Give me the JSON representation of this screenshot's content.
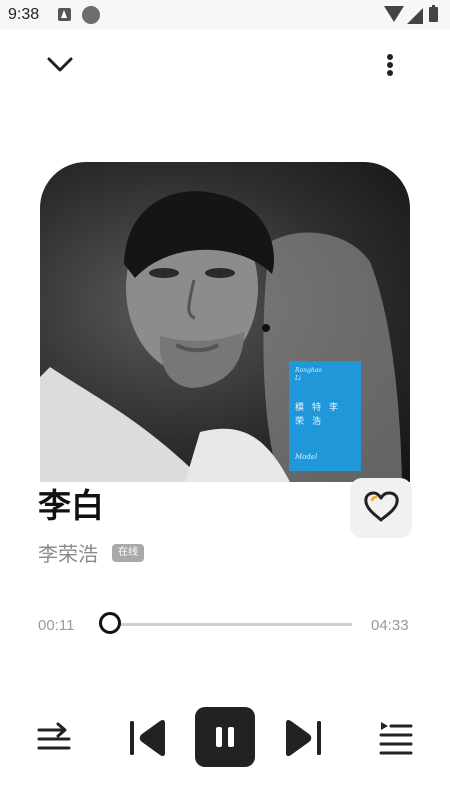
{
  "status_bar": {
    "time": "9:38",
    "icons": [
      "a-notification-icon",
      "circle-notification-icon",
      "wifi-icon",
      "cell-signal-icon",
      "battery-icon"
    ]
  },
  "header": {
    "collapse_icon": "chevron-down-icon",
    "more_icon": "more-vertical-icon"
  },
  "album": {
    "card_top_line1": "Ronghao",
    "card_top_line2": "Li",
    "card_main": "模特李荣浩",
    "card_bottom": "Model"
  },
  "song": {
    "title": "李白",
    "artist": "李荣浩",
    "badge": "在线",
    "favorite_icon": "heart-outline-icon",
    "favorite_color": "#222222"
  },
  "progress": {
    "current_time": "00:11",
    "total_time": "04:33",
    "fraction": 0.04
  },
  "controls": {
    "play_mode_icon": "play-order-icon",
    "previous_icon": "skip-previous-icon",
    "pause_icon": "pause-icon",
    "next_icon": "skip-next-icon",
    "playlist_icon": "playlist-icon"
  },
  "colors": {
    "accent": "#222222",
    "card_blue": "#1f97d8",
    "muted_text": "#8a8a8a"
  }
}
